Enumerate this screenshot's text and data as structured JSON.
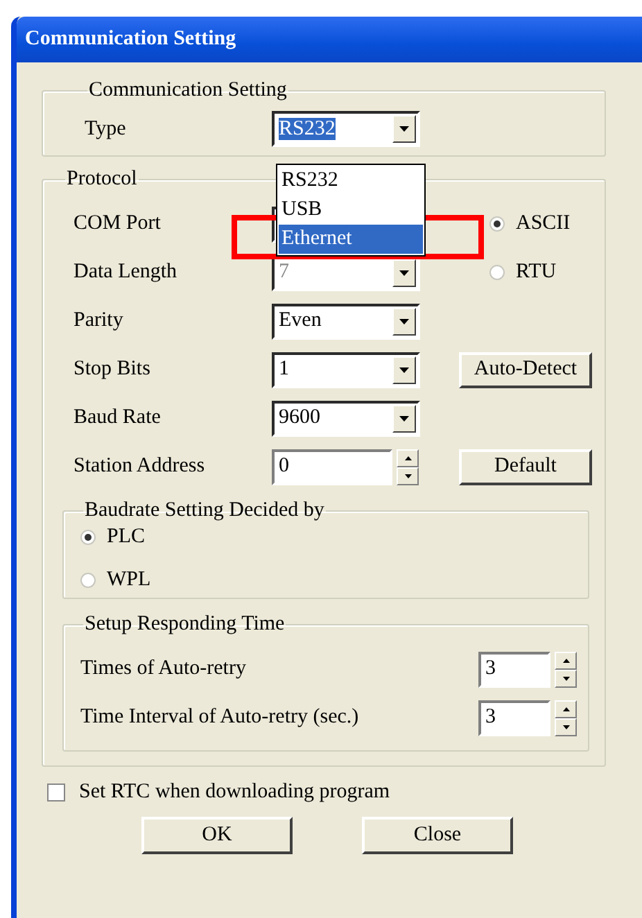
{
  "window": {
    "title": "Communication Setting"
  },
  "communication_group": {
    "title": "Communication Setting",
    "type_label": "Type",
    "type_value": "RS232",
    "dropdown": {
      "open": true,
      "options": [
        {
          "label": "RS232",
          "selected": false,
          "highlighted": false
        },
        {
          "label": "USB",
          "selected": false,
          "highlighted": false
        },
        {
          "label": "Ethernet",
          "selected": true,
          "highlighted": true
        }
      ]
    }
  },
  "protocol_group": {
    "title": "Protocol",
    "fields": [
      {
        "label": "COM Port",
        "kind": "combo"
      },
      {
        "label": "Data Length",
        "kind": "combo",
        "value": "7",
        "disabled": true
      },
      {
        "label": "Parity",
        "kind": "combo",
        "value": "Even",
        "disabled": false
      },
      {
        "label": "Stop Bits",
        "kind": "combo",
        "value": "1",
        "disabled": false
      },
      {
        "label": "Baud Rate",
        "kind": "combo",
        "value": "9600",
        "disabled": false
      },
      {
        "label": "Station Address",
        "kind": "spin",
        "value": "0"
      }
    ],
    "modes": [
      {
        "label": "ASCII",
        "selected": true
      },
      {
        "label": "RTU",
        "selected": false
      }
    ],
    "auto_detect_button": "Auto-Detect",
    "default_button": "Default",
    "baudrate_group": {
      "title": "Baudrate Setting Decided by",
      "options": [
        {
          "label": "PLC",
          "selected": true
        },
        {
          "label": "WPL",
          "selected": false
        }
      ]
    },
    "responding_group": {
      "title": "Setup Responding Time",
      "fields": [
        {
          "label": "Times of Auto-retry",
          "value": "3"
        },
        {
          "label": "Time Interval of Auto-retry (sec.)",
          "value": "3"
        }
      ]
    }
  },
  "rtc_checkbox": {
    "label": "Set RTC when downloading program",
    "checked": false
  },
  "buttons": [
    "OK",
    "Close"
  ]
}
